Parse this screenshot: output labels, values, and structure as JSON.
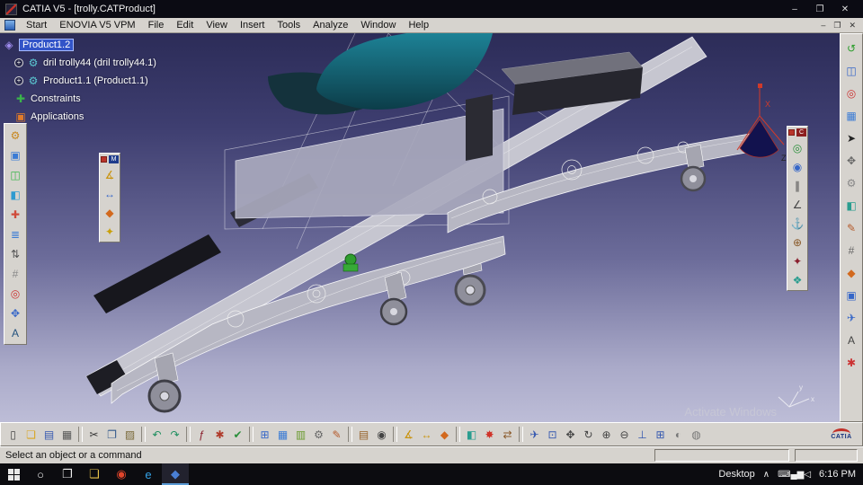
{
  "window": {
    "title": "CATIA V5 - [trolly.CATProduct]",
    "controls": [
      {
        "name": "minimize-button",
        "glyph": "–"
      },
      {
        "name": "maximize-button",
        "glyph": "❐"
      },
      {
        "name": "close-button",
        "glyph": "✕"
      }
    ]
  },
  "menu": {
    "items": [
      {
        "name": "menu-start",
        "label": "Start"
      },
      {
        "name": "menu-enovia-v5-vpm",
        "label": "ENOVIA V5 VPM"
      },
      {
        "name": "menu-file",
        "label": "File"
      },
      {
        "name": "menu-edit",
        "label": "Edit"
      },
      {
        "name": "menu-view",
        "label": "View"
      },
      {
        "name": "menu-insert",
        "label": "Insert"
      },
      {
        "name": "menu-tools",
        "label": "Tools"
      },
      {
        "name": "menu-analyze",
        "label": "Analyze"
      },
      {
        "name": "menu-window",
        "label": "Window"
      },
      {
        "name": "menu-help",
        "label": "Help"
      }
    ],
    "controls": [
      {
        "name": "mdi-minimize-button",
        "glyph": "–"
      },
      {
        "name": "mdi-restore-button",
        "glyph": "❐"
      },
      {
        "name": "mdi-close-button",
        "glyph": "✕"
      }
    ]
  },
  "tree": {
    "items": [
      {
        "name": "tree-item-product1-2",
        "label": "Product1.2",
        "glyph": "◈",
        "color": "#a08df0",
        "level": 0,
        "selected": true
      },
      {
        "name": "tree-item-dril-trolly44",
        "label": "dril trolly44 (dril trolly44.1)",
        "glyph": "⚙",
        "color": "#5bc8d2",
        "level": 1,
        "expand": true
      },
      {
        "name": "tree-item-product1-1",
        "label": "Product1.1 (Product1.1)",
        "glyph": "⚙",
        "color": "#5bc8d2",
        "level": 1,
        "expand": true
      },
      {
        "name": "tree-item-constraints",
        "label": "Constraints",
        "glyph": "✚",
        "color": "#3ab54a",
        "level": 1
      },
      {
        "name": "tree-item-applications",
        "label": "Applications",
        "glyph": "▣",
        "color": "#e07b2a",
        "level": 1
      }
    ]
  },
  "toolbars": {
    "left": {
      "items": [
        {
          "name": "gear-gold-icon",
          "glyph": "⚙",
          "color": "#c8861b"
        },
        {
          "name": "new-component-icon",
          "glyph": "▣",
          "color": "#3a7bd5"
        },
        {
          "name": "new-product-icon",
          "glyph": "◫",
          "color": "#3ab54a"
        },
        {
          "name": "new-part-icon",
          "glyph": "◧",
          "color": "#2e9ad0"
        },
        {
          "name": "fastened-constraint-icon",
          "glyph": "✚",
          "color": "#d04b3a"
        },
        {
          "name": "graph-tree-icon",
          "glyph": "≣",
          "color": "#3a7bd5"
        },
        {
          "name": "reorder-icon",
          "glyph": "⇅",
          "color": "#555555"
        },
        {
          "name": "numbering-icon",
          "glyph": "#",
          "color": "#888888"
        },
        {
          "name": "snap-icon",
          "glyph": "◎",
          "color": "#cc3333"
        },
        {
          "name": "smart-move-icon",
          "glyph": "✥",
          "color": "#3566c8"
        },
        {
          "name": "annotation-icon",
          "glyph": "A",
          "color": "#24527e"
        }
      ]
    },
    "right": {
      "items": [
        {
          "name": "update-icon",
          "glyph": "↺",
          "color": "#2a9d2a"
        },
        {
          "name": "window-layout-icon",
          "glyph": "◫",
          "color": "#3566c8"
        },
        {
          "name": "target-icon",
          "glyph": "◎",
          "color": "#cc3333"
        },
        {
          "name": "grid-snap-icon",
          "glyph": "▦",
          "color": "#3a7bd5"
        },
        {
          "name": "select-arrow-icon",
          "glyph": "➤",
          "color": "#222222"
        },
        {
          "name": "move-icon",
          "glyph": "✥",
          "color": "#666666"
        },
        {
          "name": "gear-icon",
          "glyph": "⚙",
          "color": "#888888"
        },
        {
          "name": "split-icon",
          "glyph": "◧",
          "color": "#2a9d8f"
        },
        {
          "name": "annotate-icon",
          "glyph": "✎",
          "color": "#b55a2a"
        },
        {
          "name": "hash-icon",
          "glyph": "#",
          "color": "#666666"
        },
        {
          "name": "inertia-icon",
          "glyph": "◆",
          "color": "#d2691e"
        },
        {
          "name": "frame-icon",
          "glyph": "▣",
          "color": "#3566c8"
        },
        {
          "name": "fly-mode-icon",
          "glyph": "✈",
          "color": "#3566c8"
        },
        {
          "name": "text-icon",
          "glyph": "A",
          "color": "#444444"
        },
        {
          "name": "burst-icon",
          "glyph": "✱",
          "color": "#cc3333"
        }
      ]
    },
    "palette_m": {
      "title": "M",
      "items": [
        {
          "name": "measure-item-icon",
          "glyph": "∡",
          "color": "#c9920a"
        },
        {
          "name": "measure-between-icon",
          "glyph": "↔",
          "color": "#3566c8"
        },
        {
          "name": "measure-inertia-icon",
          "glyph": "◆",
          "color": "#d2691e"
        },
        {
          "name": "star-icon",
          "glyph": "✦",
          "color": "#c9a00a"
        }
      ]
    },
    "palette_c": {
      "title": "C",
      "items": [
        {
          "name": "coincidence-constraint-icon",
          "glyph": "◎",
          "color": "#2a8f3a"
        },
        {
          "name": "contact-constraint-icon",
          "glyph": "◉",
          "color": "#3566c8"
        },
        {
          "name": "offset-constraint-icon",
          "glyph": "∥",
          "color": "#444444"
        },
        {
          "name": "angle-constraint-icon",
          "glyph": "∠",
          "color": "#444444"
        },
        {
          "name": "anchor-constraint-icon",
          "glyph": "⚓",
          "color": "#3566c8"
        },
        {
          "name": "fix-together-icon",
          "glyph": "⊕",
          "color": "#8a5a2a"
        },
        {
          "name": "quick-constraint-icon",
          "glyph": "✦",
          "color": "#8a1f2d"
        },
        {
          "name": "flexible-rigid-icon",
          "glyph": "❖",
          "color": "#2a9d8f"
        }
      ]
    },
    "bottom": {
      "items": [
        {
          "name": "new-document-icon",
          "glyph": "▯",
          "color": "#444444"
        },
        {
          "name": "open-icon",
          "glyph": "❏",
          "color": "#d9a520"
        },
        {
          "name": "save-icon",
          "glyph": "▤",
          "color": "#3558b0"
        },
        {
          "name": "print-icon",
          "glyph": "▦",
          "color": "#555555"
        },
        {
          "sep": true
        },
        {
          "name": "cut-icon",
          "glyph": "✂",
          "color": "#333333"
        },
        {
          "name": "copy-icon",
          "glyph": "❐",
          "color": "#335a8c"
        },
        {
          "name": "paste-icon",
          "glyph": "▨",
          "color": "#7a6a3a"
        },
        {
          "sep": true
        },
        {
          "name": "undo-icon",
          "glyph": "↶",
          "color": "#1f8f5f"
        },
        {
          "name": "redo-icon",
          "glyph": "↷",
          "color": "#1f8f5f"
        },
        {
          "sep": true
        },
        {
          "name": "fx-icon",
          "glyph": "ƒ",
          "color": "#8a1f2d"
        },
        {
          "name": "rule-icon",
          "glyph": "✱",
          "color": "#b03a2a"
        },
        {
          "name": "check-icon",
          "glyph": "✔",
          "color": "#2a8f3a"
        },
        {
          "sep": true
        },
        {
          "name": "calculator-icon",
          "glyph": "⊞",
          "color": "#3566c8"
        },
        {
          "name": "grid-icon",
          "glyph": "▦",
          "color": "#3a7bd5"
        },
        {
          "name": "chart-icon",
          "glyph": "▥",
          "color": "#6a9a2f"
        },
        {
          "name": "gears-icon",
          "glyph": "⚙",
          "color": "#666666"
        },
        {
          "name": "pen-icon",
          "glyph": "✎",
          "color": "#b55a2a"
        },
        {
          "sep": true
        },
        {
          "name": "catalog-icon",
          "glyph": "▤",
          "color": "#96622a"
        },
        {
          "name": "camera-icon",
          "glyph": "◉",
          "color": "#444444"
        },
        {
          "sep": true
        },
        {
          "name": "measure-icon",
          "glyph": "∡",
          "color": "#c9920a"
        },
        {
          "name": "measure-between-icon",
          "glyph": "↔",
          "color": "#c9920a"
        },
        {
          "name": "inertia-icon",
          "glyph": "◆",
          "color": "#d2691e"
        },
        {
          "sep": true
        },
        {
          "name": "sectioning-icon",
          "glyph": "◧",
          "color": "#2a9d8f"
        },
        {
          "name": "clash-icon",
          "glyph": "✸",
          "color": "#d0342a"
        },
        {
          "name": "swap-icon",
          "glyph": "⇄",
          "color": "#8a5a2a"
        },
        {
          "sep": true
        },
        {
          "name": "fly-icon",
          "glyph": "✈",
          "color": "#3558b0"
        },
        {
          "name": "fit-all-icon",
          "glyph": "⊡",
          "color": "#3558b0"
        },
        {
          "name": "pan-icon",
          "glyph": "✥",
          "color": "#444444"
        },
        {
          "name": "rotate-icon",
          "glyph": "↻",
          "color": "#444444"
        },
        {
          "name": "zoom-in-icon",
          "glyph": "⊕",
          "color": "#444444"
        },
        {
          "name": "zoom-out-icon",
          "glyph": "⊖",
          "color": "#444444"
        },
        {
          "name": "normal-view-icon",
          "glyph": "⊥",
          "color": "#3558b0"
        },
        {
          "name": "multi-view-icon",
          "glyph": "⊞",
          "color": "#3558b0"
        },
        {
          "name": "shading-icon",
          "glyph": "◐",
          "color": "#777777"
        },
        {
          "name": "hide-show-icon",
          "glyph": "◍",
          "color": "#777777"
        }
      ]
    }
  },
  "viewport": {
    "watermark": "Activate Windows",
    "compass": {
      "x": "X",
      "z": "Z"
    },
    "mini_axis": {
      "x": "x",
      "y": "y"
    }
  },
  "status": {
    "message": "Select an object or a command"
  },
  "taskbar": {
    "desktop_label": "Desktop",
    "chevron": "∧",
    "time": "6:16 PM",
    "system": [
      {
        "name": "cortana-button",
        "glyph": "○",
        "color": "#eeeeee"
      },
      {
        "name": "task-view-button",
        "glyph": "❐",
        "color": "#eeeeee"
      }
    ],
    "apps": [
      {
        "name": "file-explorer-button",
        "glyph": "❏",
        "color": "#e8c24a"
      },
      {
        "name": "browser-red-button",
        "glyph": "◉",
        "color": "#e0452b"
      },
      {
        "name": "edge-button",
        "glyph": "e",
        "color": "#35a3e8"
      },
      {
        "name": "catia-taskbar-button",
        "glyph": "◆",
        "color": "#4a7fd4",
        "selected": true
      }
    ],
    "tray": [
      {
        "name": "keyboard-icon",
        "glyph": "⌨",
        "color": "#eeeeee"
      },
      {
        "name": "network-icon",
        "glyph": "▄▆",
        "color": "#eeeeee"
      },
      {
        "name": "volume-icon",
        "glyph": "◁",
        "color": "#eeeeee"
      }
    ]
  },
  "brand": {
    "catia": "CATIA"
  },
  "colors": {
    "accent_selection": "#3254c8",
    "viewport_top": "#2c2c58",
    "viewport_bottom": "#bdbdd7",
    "model_teal": "#14606f",
    "model_green": "#2f9e2f",
    "logo_red": "#c03028",
    "logo_blue": "#16337e"
  }
}
